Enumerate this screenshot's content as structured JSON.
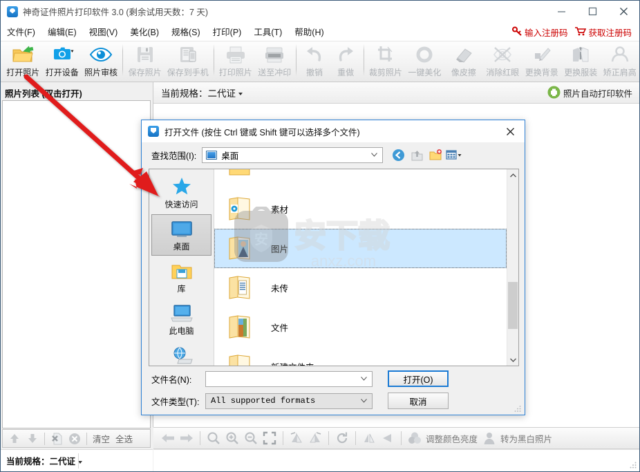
{
  "window": {
    "title": "神奇证件照片打印软件 3.0 (剩余试用天数：7 天)",
    "icon": "app-logo-icon",
    "minimize": "minimize-icon",
    "maximize": "maximize-icon",
    "close": "close-icon"
  },
  "menubar": {
    "items": [
      {
        "label": "文件(F)"
      },
      {
        "label": "编辑(E)"
      },
      {
        "label": "视图(V)"
      },
      {
        "label": "美化(B)"
      },
      {
        "label": "规格(S)"
      },
      {
        "label": "打印(P)"
      },
      {
        "label": "工具(T)"
      },
      {
        "label": "帮助(H)"
      }
    ],
    "register": [
      {
        "label": "输入注册码",
        "icon": "key-icon",
        "color": "#cc0000"
      },
      {
        "label": "获取注册码",
        "icon": "cart-icon",
        "color": "#cc0000"
      }
    ]
  },
  "toolbar": {
    "buttons": [
      {
        "label": "打开照片",
        "icon": "open-folder-icon",
        "enabled": true
      },
      {
        "label": "打开设备",
        "icon": "camera-icon",
        "enabled": true
      },
      {
        "label": "照片审核",
        "icon": "eye-icon",
        "enabled": true
      },
      {
        "label": "保存照片",
        "icon": "save-disk-icon",
        "enabled": false
      },
      {
        "label": "保存到手机",
        "icon": "save-phone-icon",
        "enabled": false
      },
      {
        "label": "打印照片",
        "icon": "printer-icon",
        "enabled": false
      },
      {
        "label": "送至冲印",
        "icon": "send-print-icon",
        "enabled": false
      },
      {
        "label": "撤销",
        "icon": "undo-icon",
        "enabled": false
      },
      {
        "label": "重做",
        "icon": "redo-icon",
        "enabled": false
      },
      {
        "label": "裁剪照片",
        "icon": "crop-icon",
        "enabled": false
      },
      {
        "label": "一键美化",
        "icon": "beautify-ring-icon",
        "enabled": false
      },
      {
        "label": "像皮擦",
        "icon": "eraser-icon",
        "enabled": false
      },
      {
        "label": "消除红眼",
        "icon": "red-eye-icon",
        "enabled": false
      },
      {
        "label": "更换背景",
        "icon": "background-brush-icon",
        "enabled": false
      },
      {
        "label": "更换服装",
        "icon": "clothes-icon",
        "enabled": false
      },
      {
        "label": "矫正肩高",
        "icon": "shoulder-icon",
        "enabled": false
      }
    ]
  },
  "left_panel": {
    "title": "照片列表 (双击打开)",
    "tools": [
      {
        "name": "move-up-icon",
        "label": ""
      },
      {
        "name": "move-down-icon",
        "label": ""
      },
      {
        "name": "remove-file-icon",
        "label": ""
      },
      {
        "name": "clear-all-icon",
        "label": ""
      }
    ],
    "clear_label": "清空",
    "select_all_label": "全选"
  },
  "status_bar": {
    "spec_label": "当前规格：",
    "spec_value": "二代证"
  },
  "main": {
    "spec_label": "当前规格：",
    "spec_value": "二代证",
    "autoprint_label": "照片自动打印软件",
    "autoprint_icon": "auto-printer-icon"
  },
  "bottom_toolbar": {
    "icons": [
      {
        "name": "prev-photo-icon"
      },
      {
        "name": "next-photo-icon"
      },
      {
        "name": "zoom-actual-icon"
      },
      {
        "name": "zoom-in-icon"
      },
      {
        "name": "zoom-out-icon"
      },
      {
        "name": "fit-screen-icon"
      },
      {
        "name": "rotate-left-icon"
      },
      {
        "name": "rotate-right-icon"
      },
      {
        "name": "refresh-icon"
      },
      {
        "name": "flip-horizontal-icon"
      },
      {
        "name": "flip-vertical-icon"
      }
    ],
    "color_label": "调整颜色亮度",
    "color_icon": "color-circles-icon",
    "bw_label": "转为黑白照片",
    "bw_icon": "person-silhouette-icon"
  },
  "dialog": {
    "title": "打开文件 (按住 Ctrl 键或 Shift 键可以选择多个文件)",
    "icon": "app-logo-icon",
    "close": "close-icon",
    "lookin_label": "查找范围(I):",
    "lookin_value": "桌面",
    "lookin_icon": "desktop-monitor-icon",
    "nav_icons": [
      {
        "name": "back-icon"
      },
      {
        "name": "up-folder-icon"
      },
      {
        "name": "new-folder-icon"
      },
      {
        "name": "view-mode-icon"
      }
    ],
    "places": [
      {
        "label": "快速访问",
        "icon": "star-icon",
        "selected": false
      },
      {
        "label": "桌面",
        "icon": "desktop-monitor-icon",
        "selected": true
      },
      {
        "label": "库",
        "icon": "library-icon",
        "selected": false
      },
      {
        "label": "此电脑",
        "icon": "this-pc-icon",
        "selected": false
      },
      {
        "label": "网络",
        "icon": "network-icon",
        "selected": false
      }
    ],
    "files": [
      {
        "name": "",
        "icon": "folder-icon",
        "selected": false,
        "partial": true
      },
      {
        "name": "素材",
        "icon": "folder-media-icon",
        "selected": false
      },
      {
        "name": "图片",
        "icon": "folder-pictures-icon",
        "selected": true
      },
      {
        "name": "未传",
        "icon": "folder-docs-icon",
        "selected": false
      },
      {
        "name": "文件",
        "icon": "folder-images-icon",
        "selected": false
      },
      {
        "name": "新建文件夹",
        "icon": "folder-icon",
        "selected": false
      }
    ],
    "filename_label": "文件名(N):",
    "filename_value": "",
    "filetype_label": "文件类型(T):",
    "filetype_value": "All supported formats",
    "open_button": "打开(O)",
    "cancel_button": "取消"
  },
  "watermark": {
    "text": "安下载",
    "url": "anxz.com"
  },
  "annotation": {
    "arrow_color": "#e01b1b",
    "name": "red-pointer-arrow"
  }
}
